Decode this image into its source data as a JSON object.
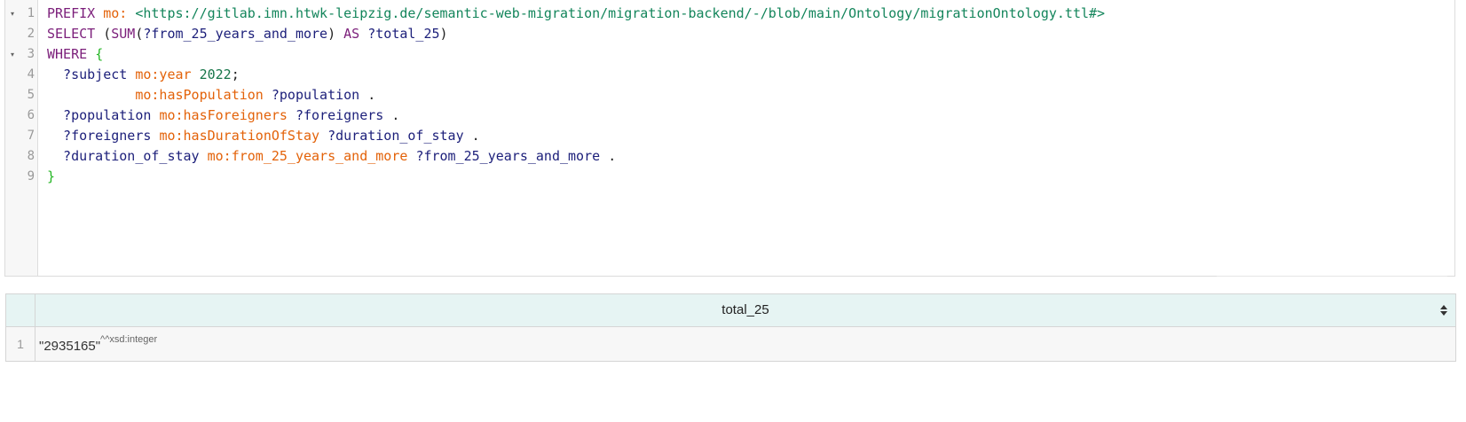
{
  "editor": {
    "line_numbers": [
      "1",
      "2",
      "3",
      "4",
      "5",
      "6",
      "7",
      "8",
      "9"
    ],
    "fold_marker": "▾",
    "lines": [
      [
        {
          "t": "PREFIX ",
          "c": "kw"
        },
        {
          "t": "mo: ",
          "c": "pfx"
        },
        {
          "t": "<https://gitlab.imn.htwk-leipzig.de/semantic-web-migration/migration-backend/-/blob/main/Ontology/migrationOntology.ttl#>",
          "c": "iri"
        }
      ],
      [
        {
          "t": "SELECT ",
          "c": "kw"
        },
        {
          "t": "(",
          "c": "punct"
        },
        {
          "t": "SUM",
          "c": "kw"
        },
        {
          "t": "(",
          "c": "punct"
        },
        {
          "t": "?from_25_years_and_more",
          "c": "var"
        },
        {
          "t": ") ",
          "c": "punct"
        },
        {
          "t": "AS ",
          "c": "kw"
        },
        {
          "t": "?total_25",
          "c": "var"
        },
        {
          "t": ")",
          "c": "punct"
        }
      ],
      [
        {
          "t": "WHERE ",
          "c": "kw"
        },
        {
          "t": "{",
          "c": "brace"
        }
      ],
      [
        {
          "t": "  ?subject ",
          "c": "var"
        },
        {
          "t": "mo:year ",
          "c": "pfx"
        },
        {
          "t": "2022",
          "c": "lit"
        },
        {
          "t": ";",
          "c": "punct"
        }
      ],
      [
        {
          "t": "           mo:hasPopulation ",
          "c": "pfx"
        },
        {
          "t": "?population ",
          "c": "var"
        },
        {
          "t": ".",
          "c": "punct"
        }
      ],
      [
        {
          "t": "  ?population ",
          "c": "var"
        },
        {
          "t": "mo:hasForeigners ",
          "c": "pfx"
        },
        {
          "t": "?foreigners ",
          "c": "var"
        },
        {
          "t": ".",
          "c": "punct"
        }
      ],
      [
        {
          "t": "  ?foreigners ",
          "c": "var"
        },
        {
          "t": "mo:hasDurationOfStay ",
          "c": "pfx"
        },
        {
          "t": "?duration_of_stay ",
          "c": "var"
        },
        {
          "t": ".",
          "c": "punct"
        }
      ],
      [
        {
          "t": "  ?duration_of_stay ",
          "c": "var"
        },
        {
          "t": "mo:from_25_years_and_more ",
          "c": "pfx"
        },
        {
          "t": "?from_25_years_and_more ",
          "c": "var"
        },
        {
          "t": ".",
          "c": "punct"
        }
      ],
      [
        {
          "t": "}",
          "c": "brace"
        }
      ]
    ]
  },
  "results": {
    "column": "total_25",
    "rows": [
      {
        "num": "1",
        "value": "\"2935165\"",
        "datatype": "^^xsd:integer"
      }
    ]
  }
}
